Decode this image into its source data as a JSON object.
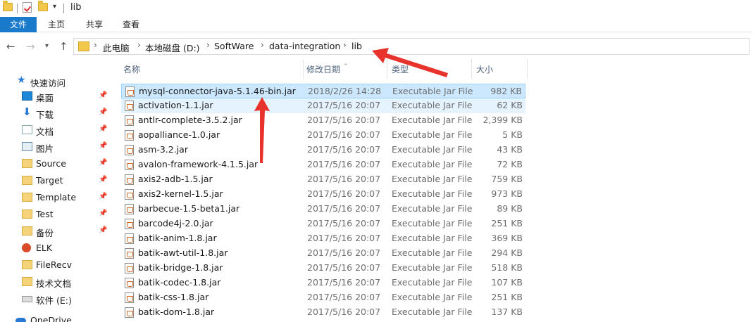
{
  "window": {
    "title": "lib"
  },
  "ribbon": {
    "tabs": [
      "文件",
      "主页",
      "共享",
      "查看"
    ]
  },
  "address": {
    "crumbs": [
      "此电脑",
      "本地磁盘 (D:)",
      "SoftWare",
      "data-integration",
      "lib"
    ]
  },
  "sidebar": {
    "quick_access": "快速访问",
    "items": [
      {
        "label": "桌面",
        "icon": "desktop-icon",
        "pinned": true
      },
      {
        "label": "下载",
        "icon": "download-icon",
        "pinned": true
      },
      {
        "label": "文档",
        "icon": "document-icon",
        "pinned": true
      },
      {
        "label": "图片",
        "icon": "picture-icon",
        "pinned": true
      },
      {
        "label": "Source",
        "icon": "folder-icon",
        "pinned": true
      },
      {
        "label": "Target",
        "icon": "folder-icon",
        "pinned": true
      },
      {
        "label": "Template",
        "icon": "folder-icon",
        "pinned": true
      },
      {
        "label": "Test",
        "icon": "folder-icon",
        "pinned": true
      },
      {
        "label": "备份",
        "icon": "folder-icon",
        "pinned": true
      },
      {
        "label": "ELK",
        "icon": "elk-icon",
        "pinned": false
      },
      {
        "label": "FileRecv",
        "icon": "folder-icon",
        "pinned": false
      },
      {
        "label": "技术文档",
        "icon": "folder-icon",
        "pinned": false
      },
      {
        "label": "软件 (E:)",
        "icon": "drive-icon",
        "pinned": false
      },
      {
        "label": "OneDrive",
        "icon": "cloud-icon",
        "pinned": false
      }
    ]
  },
  "columns": {
    "name": "名称",
    "date": "修改日期",
    "type": "类型",
    "size": "大小"
  },
  "files": [
    {
      "name": "mysql-connector-java-5.1.46-bin.jar",
      "date": "2018/2/26 14:28",
      "type": "Executable Jar File",
      "size": "982 KB",
      "state": "selected"
    },
    {
      "name": "activation-1.1.jar",
      "date": "2017/5/16 20:07",
      "type": "Executable Jar File",
      "size": "62 KB",
      "state": "hover"
    },
    {
      "name": "antlr-complete-3.5.2.jar",
      "date": "2017/5/16 20:07",
      "type": "Executable Jar File",
      "size": "2,399 KB",
      "state": ""
    },
    {
      "name": "aopalliance-1.0.jar",
      "date": "2017/5/16 20:07",
      "type": "Executable Jar File",
      "size": "5 KB",
      "state": ""
    },
    {
      "name": "asm-3.2.jar",
      "date": "2017/5/16 20:07",
      "type": "Executable Jar File",
      "size": "43 KB",
      "state": ""
    },
    {
      "name": "avalon-framework-4.1.5.jar",
      "date": "2017/5/16 20:07",
      "type": "Executable Jar File",
      "size": "72 KB",
      "state": ""
    },
    {
      "name": "axis2-adb-1.5.jar",
      "date": "2017/5/16 20:07",
      "type": "Executable Jar File",
      "size": "759 KB",
      "state": ""
    },
    {
      "name": "axis2-kernel-1.5.jar",
      "date": "2017/5/16 20:07",
      "type": "Executable Jar File",
      "size": "973 KB",
      "state": ""
    },
    {
      "name": "barbecue-1.5-beta1.jar",
      "date": "2017/5/16 20:07",
      "type": "Executable Jar File",
      "size": "89 KB",
      "state": ""
    },
    {
      "name": "barcode4j-2.0.jar",
      "date": "2017/5/16 20:07",
      "type": "Executable Jar File",
      "size": "251 KB",
      "state": ""
    },
    {
      "name": "batik-anim-1.8.jar",
      "date": "2017/5/16 20:07",
      "type": "Executable Jar File",
      "size": "369 KB",
      "state": ""
    },
    {
      "name": "batik-awt-util-1.8.jar",
      "date": "2017/5/16 20:07",
      "type": "Executable Jar File",
      "size": "294 KB",
      "state": ""
    },
    {
      "name": "batik-bridge-1.8.jar",
      "date": "2017/5/16 20:07",
      "type": "Executable Jar File",
      "size": "518 KB",
      "state": ""
    },
    {
      "name": "batik-codec-1.8.jar",
      "date": "2017/5/16 20:07",
      "type": "Executable Jar File",
      "size": "107 KB",
      "state": ""
    },
    {
      "name": "batik-css-1.8.jar",
      "date": "2017/5/16 20:07",
      "type": "Executable Jar File",
      "size": "251 KB",
      "state": ""
    },
    {
      "name": "batik-dom-1.8.jar",
      "date": "2017/5/16 20:07",
      "type": "Executable Jar File",
      "size": "137 KB",
      "state": ""
    }
  ],
  "colors": {
    "accent": "#1979ca",
    "selection": "#cce8ff",
    "hover": "#e5f3ff",
    "annotation": "#e8322c"
  }
}
